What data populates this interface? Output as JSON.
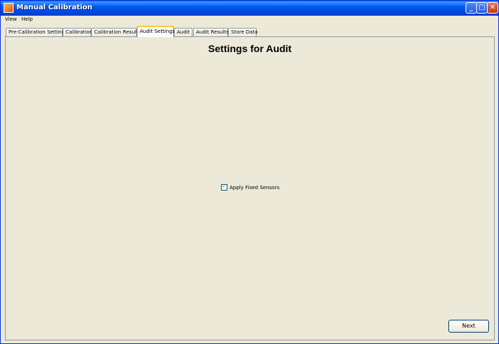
{
  "window": {
    "title": "Manual Calibration"
  },
  "menu": {
    "items": [
      "View",
      "Help"
    ]
  },
  "tabs": [
    "Pre-Calibration Settings",
    "Calibration",
    "Calibration Results",
    "Audit Settings",
    "Audit",
    "Audit Results",
    "Store Data"
  ],
  "active_tab": "Audit Settings",
  "panel": {
    "heading": "Settings for Audit",
    "checkbox": {
      "label": "Apply Fixed Sensors",
      "checked": true
    },
    "next_label": "Next"
  }
}
